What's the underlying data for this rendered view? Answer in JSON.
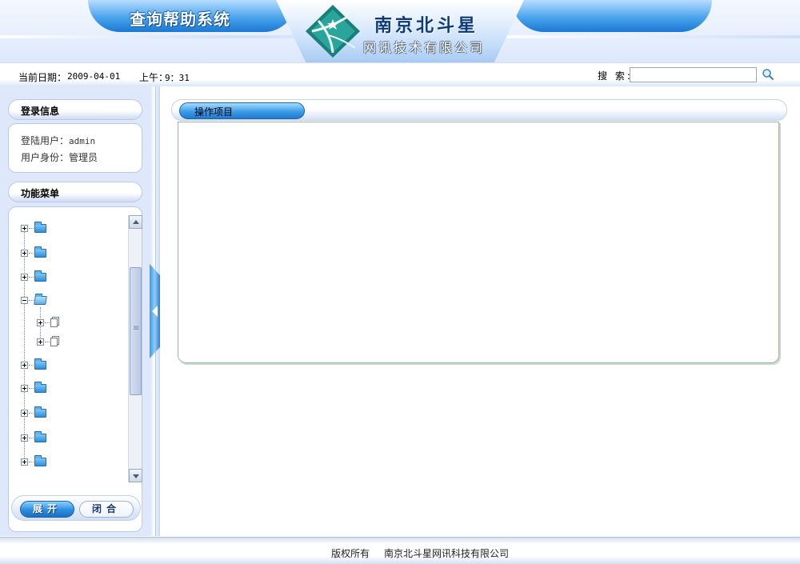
{
  "header": {
    "system_title": "查询帮助系统",
    "company_name": "南京北斗星",
    "company_sub": "网讯技术有限公司"
  },
  "infobar": {
    "date_label": "当前日期：",
    "date_value": "2009-04-01",
    "time_label": "上午：",
    "time_value": "9：31",
    "search_label": "搜 索:",
    "search_value": "",
    "search_icon": "magnifier-icon"
  },
  "sidebar": {
    "login_title": "登录信息",
    "login_user_label": "登陆用户：",
    "login_user_value": "admin",
    "login_role_label": "用户身份：",
    "login_role_value": "管理员",
    "menu_title": "功能菜单",
    "tree": [
      {
        "kind": "folder",
        "state": "collapsed",
        "label": ""
      },
      {
        "kind": "folder",
        "state": "collapsed",
        "label": ""
      },
      {
        "kind": "folder",
        "state": "collapsed",
        "label": ""
      },
      {
        "kind": "folder",
        "state": "expanded",
        "label": "",
        "children": [
          {
            "kind": "document",
            "state": "collapsed",
            "label": ""
          },
          {
            "kind": "document",
            "state": "collapsed",
            "label": ""
          }
        ]
      },
      {
        "kind": "folder",
        "state": "collapsed",
        "label": ""
      },
      {
        "kind": "folder",
        "state": "collapsed",
        "label": ""
      },
      {
        "kind": "folder",
        "state": "collapsed",
        "label": ""
      },
      {
        "kind": "folder",
        "state": "collapsed",
        "label": ""
      },
      {
        "kind": "folder",
        "state": "collapsed",
        "label": ""
      }
    ],
    "expand_button": "展开",
    "collapse_button": "闭合"
  },
  "main": {
    "tab_title": "操作项目"
  },
  "footer": {
    "copyright": "版权所有",
    "company": "南京北斗星网讯科技有限公司"
  },
  "colors": {
    "accent_blue": "#2a8ee0",
    "panel_bg": "#dfe8fb",
    "border": "#b9cbe6"
  }
}
